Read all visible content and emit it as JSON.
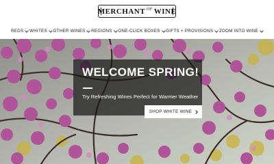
{
  "brand": {
    "logo_left": "MERCHANT",
    "logo_mid": "OF",
    "logo_right": "WINE"
  },
  "nav": {
    "items": [
      {
        "label": "REDS"
      },
      {
        "label": "WHITES"
      },
      {
        "label": "OTHER WINES"
      },
      {
        "label": "REGIONS"
      },
      {
        "label": "ONE-CLICK BOXES"
      },
      {
        "label": "GIFTS + PROVISIONS"
      },
      {
        "label": "ZOOM INTO WINE"
      }
    ]
  },
  "hero": {
    "title": "WELCOME SPRING!",
    "subtitle": "Try Refreshing Wines Perfect for Warmer Weather",
    "cta_label": "SHOP WHITE WINE"
  },
  "colors": {
    "overlay": "#191919",
    "blossom": "#b0549a",
    "leaf": "#c9b23a"
  }
}
